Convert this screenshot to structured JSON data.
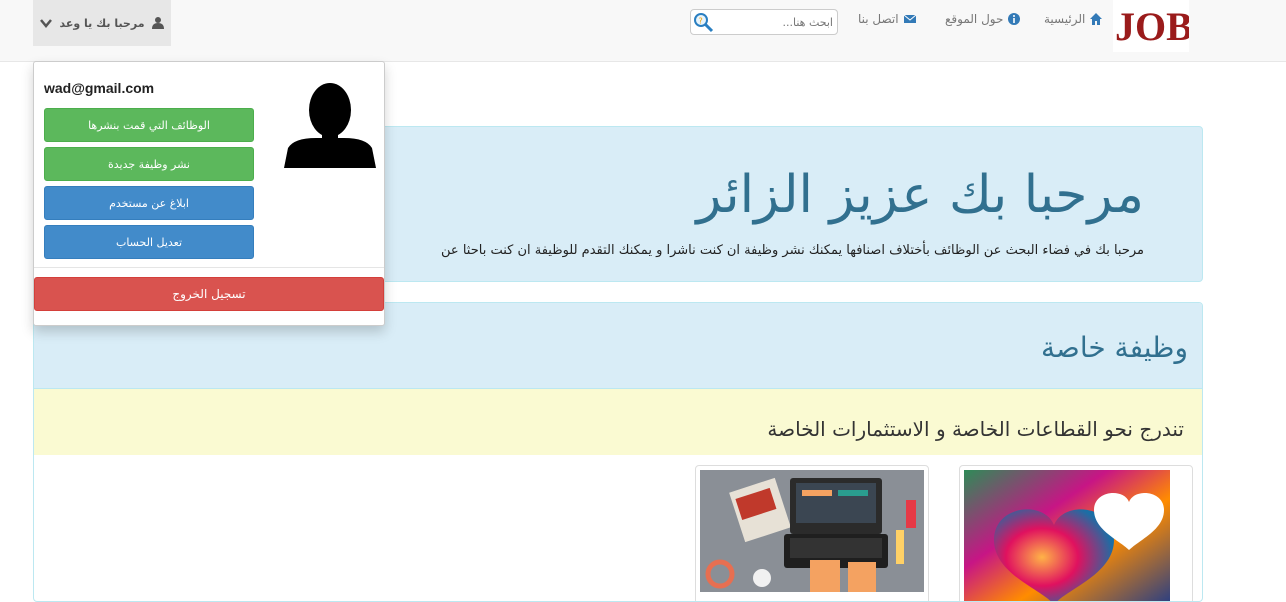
{
  "navbar": {
    "logo_text": "JOB",
    "home": "الرئيسية",
    "about": "حول الموقع",
    "contact": "اتصل بنا",
    "search_placeholder": "ابحث هنا...",
    "user_greeting": "مرحبا بك يا وعد"
  },
  "dropdown": {
    "email": "wad@gmail.com",
    "my_jobs": "الوظائف التي قمت بنشرها",
    "post_job": "نشر وظيفة جديدة",
    "report_user": "ابلاغ عن مستخدم",
    "edit_account": "تعديل الحساب",
    "logout": "تسجيل الخروج"
  },
  "jumbotron": {
    "title": "مرحبا بك عزيز الزائر",
    "text": "مرحبا بك في فضاء البحث عن الوظائف بأختلاف اصنافها يمكنك نشر وظيفة ان كنت ناشرا و يمكنك التقدم للوظيفة ان كنت باحثا عن"
  },
  "panel": {
    "heading": "وظيفة خاصة",
    "subheading": "تندرج نحو القطاعات الخاصة و الاستثمارات الخاصة"
  },
  "colors": {
    "success": "#5cb85c",
    "primary": "#428bca",
    "danger": "#d9534f",
    "info_bg": "#d9edf7",
    "info_text": "#31708f"
  }
}
